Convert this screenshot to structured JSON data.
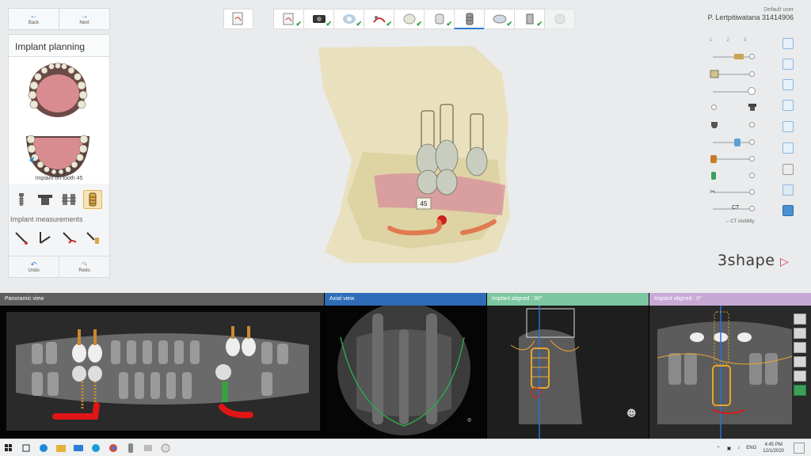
{
  "nav": {
    "back_label": "Back",
    "next_label": "Next"
  },
  "left_panel": {
    "title": "Implant planning",
    "implant_caption": "Implant on tooth 45",
    "measurements_heading": "Implant measurements",
    "undo_label": "Undo",
    "redo_label": "Redo"
  },
  "workflow": {
    "steps": [
      {
        "icon": "scan-doc-icon",
        "done": true
      },
      {
        "icon": "ct-scan-icon",
        "done": true
      },
      {
        "icon": "alignment-icon",
        "done": true
      },
      {
        "icon": "nerve-icon",
        "done": true
      },
      {
        "icon": "crown-icon",
        "done": true
      },
      {
        "icon": "tooth-setup-icon",
        "done": true
      },
      {
        "icon": "implant-icon",
        "done": false,
        "active": true
      },
      {
        "icon": "guide-icon",
        "done": true
      },
      {
        "icon": "sleeve-icon",
        "done": true
      },
      {
        "icon": "export-icon",
        "done": false,
        "disabled": true
      }
    ]
  },
  "user": {
    "role": "Default user",
    "patient": "P. Lertpitiwatana 31414906"
  },
  "right_toolbar": {
    "layer_tabs": [
      "1",
      "2",
      "3"
    ],
    "ct_visibility_label": "CT visibility",
    "ct_label": "CT"
  },
  "viewer": {
    "tooth_label": "45",
    "logo": "3shape"
  },
  "views": {
    "panoramic": {
      "title": "Panoramic view",
      "color": "#5e5e5e"
    },
    "axial": {
      "title": "Axial view",
      "color": "#2f6cb8"
    },
    "aligned90": {
      "title": "Implant aligned : 90°",
      "color": "#7cc6a2"
    },
    "aligned0": {
      "title": "Implant aligned : 0°",
      "color": "#c8a9d6"
    }
  },
  "taskbar": {
    "time": "4:45 PM",
    "date": "12/1/2020",
    "lang": "ENG"
  },
  "colors": {
    "accent": "#2b7fd6",
    "check": "#2a9d3a",
    "nerve": "#e07a50",
    "bone": "#e8dfb8"
  }
}
